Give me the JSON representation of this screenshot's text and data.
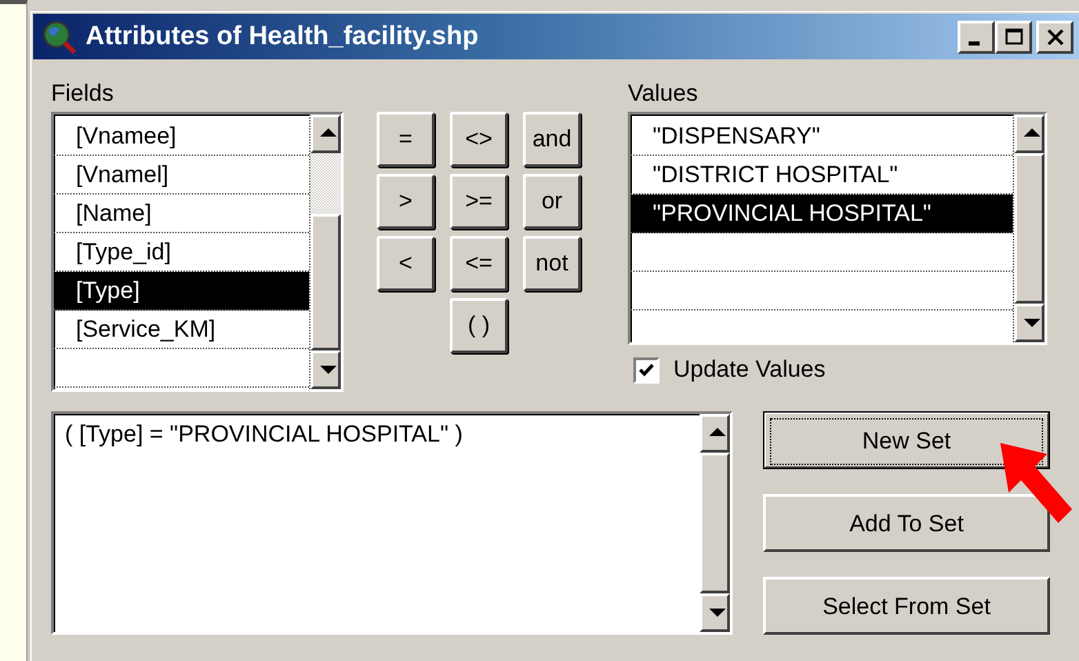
{
  "window": {
    "title": "Attributes of Health_facility.shp"
  },
  "fields": {
    "label": "Fields",
    "items": [
      {
        "label": "[Vnamee]",
        "selected": false
      },
      {
        "label": "[Vnamel]",
        "selected": false
      },
      {
        "label": "[Name]",
        "selected": false
      },
      {
        "label": "[Type_id]",
        "selected": false
      },
      {
        "label": "[Type]",
        "selected": true
      },
      {
        "label": "[Service_KM]",
        "selected": false
      }
    ]
  },
  "operators": [
    "=",
    "<>",
    "and",
    ">",
    ">=",
    "or",
    "<",
    "<=",
    "not",
    "( )"
  ],
  "values": {
    "label": "Values",
    "items": [
      {
        "label": "\"DISPENSARY\"",
        "selected": false
      },
      {
        "label": "\"DISTRICT HOSPITAL\"",
        "selected": false
      },
      {
        "label": "\"PROVINCIAL HOSPITAL\"",
        "selected": true
      }
    ]
  },
  "update_values": {
    "label": "Update Values",
    "checked": true
  },
  "expression": {
    "value": "( [Type] = \"PROVINCIAL HOSPITAL\" )"
  },
  "buttons": [
    {
      "label": "New Set",
      "focused": true
    },
    {
      "label": "Add To Set",
      "focused": false
    },
    {
      "label": "Select From Set",
      "focused": false
    }
  ]
}
